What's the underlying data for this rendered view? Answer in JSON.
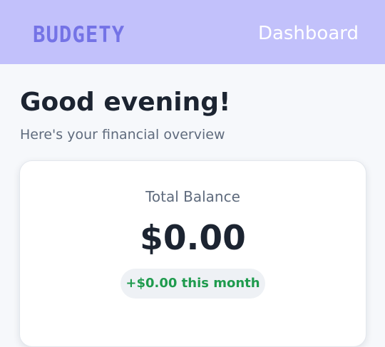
{
  "header": {
    "brand": "BUDGETY",
    "nav_label": "Dashboard"
  },
  "main": {
    "greeting": "Good evening!",
    "subtitle": "Here's your financial overview"
  },
  "balance_card": {
    "label": "Total Balance",
    "amount": "$0.00",
    "change": "+$0.00 this month"
  },
  "colors": {
    "header_bg": "#c2c1fb",
    "brand": "#7473e6",
    "nav_text": "#ffffff",
    "page_bg": "#f6f8fb",
    "heading_text": "#1c2431",
    "muted_text": "#5f6b7d",
    "positive_change": "#1f9b4e",
    "pill_bg": "#eef1f5"
  }
}
